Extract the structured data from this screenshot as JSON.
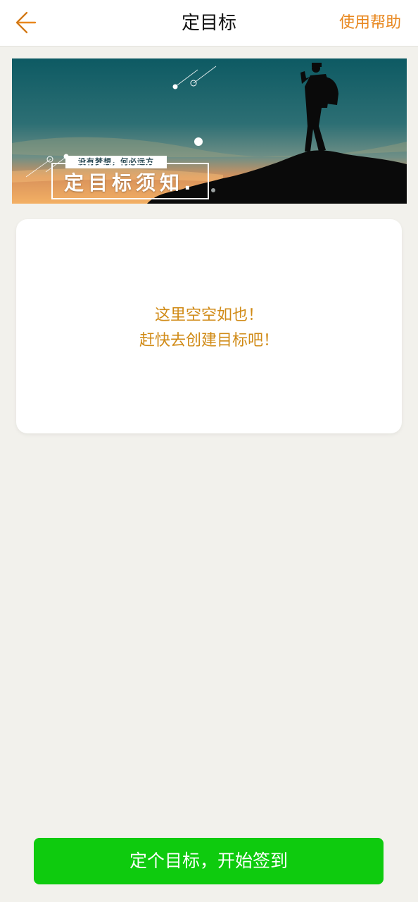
{
  "header": {
    "back_icon": "chevron-left-icon",
    "title": "定目标",
    "help_label": "使用帮助",
    "accent_color": "#e8871e"
  },
  "banner": {
    "subtitle": "没有梦想，何必远方",
    "title": "定目标须知.",
    "slide_index": 1,
    "slide_count": 1
  },
  "empty_state": {
    "line1": "这里空空如也！",
    "line2": "赶快去创建目标吧！",
    "color": "#d08a15"
  },
  "footer": {
    "button_label": "定个目标，开始签到",
    "button_color": "#0ecb0e"
  }
}
